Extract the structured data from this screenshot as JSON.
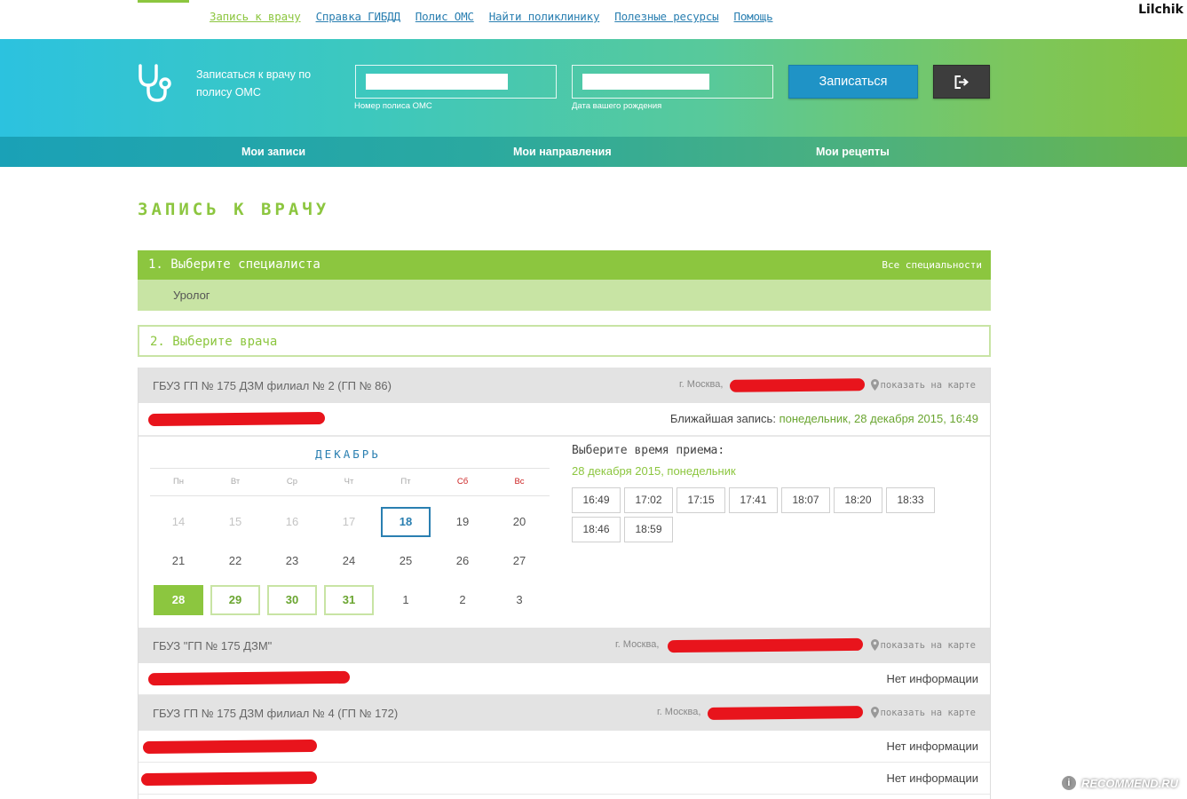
{
  "top_nav": {
    "items": [
      {
        "label": "Запись к врачу",
        "active": true
      },
      {
        "label": "Справка ГИБДД"
      },
      {
        "label": "Полис ОМС"
      },
      {
        "label": "Найти поликлинику"
      },
      {
        "label": "Полезные ресурсы"
      },
      {
        "label": "Помощь"
      }
    ],
    "user": "Lilchik"
  },
  "banner": {
    "icon": "stethoscope-icon",
    "title": "Записаться к врачу по полису ОМС",
    "policy_label": "Номер полиса ОМС",
    "birth_label": "Дата вашего рождения",
    "submit_label": "Записаться",
    "logout_icon": "logout-icon"
  },
  "subnav": [
    "Мои записи",
    "Мои направления",
    "Мои рецепты"
  ],
  "page_title": "ЗАПИСЬ К ВРАЧУ",
  "step1": {
    "title": "1. Выберите специалиста",
    "all_link": "Все специальности",
    "value": "Уролог"
  },
  "step2": {
    "title": "2. Выберите врача"
  },
  "clinics": [
    {
      "name": "ГБУЗ ГП № 175 ДЗМ филиал № 2 (ГП № 86)",
      "city": "г. Москва,",
      "map_link": "показать на карте",
      "doctors": [
        {
          "nearest_label": "Ближайшая запись:",
          "nearest_value": "понедельник, 28 декабря 2015, 16:49"
        }
      ]
    },
    {
      "name": "ГБУЗ \"ГП № 175 ДЗМ\"",
      "city": "г. Москва,",
      "map_link": "показать на карте",
      "doctors": [
        {
          "info": "Нет информации"
        }
      ]
    },
    {
      "name": "ГБУЗ ГП № 175 ДЗМ филиал № 4 (ГП № 172)",
      "city": "г. Москва,",
      "map_link": "показать на карте",
      "doctors": [
        {
          "info": "Нет информации"
        },
        {
          "info": "Нет информации"
        }
      ]
    }
  ],
  "calendar": {
    "month": "ДЕКАБРЬ",
    "weekdays": [
      "Пн",
      "Вт",
      "Ср",
      "Чт",
      "Пт",
      "Сб",
      "Вс"
    ],
    "weeks": [
      [
        {
          "d": "14",
          "s": "past"
        },
        {
          "d": "15",
          "s": "past"
        },
        {
          "d": "16",
          "s": "past"
        },
        {
          "d": "17",
          "s": "past"
        },
        {
          "d": "18",
          "s": "today"
        },
        {
          "d": "19",
          "s": ""
        },
        {
          "d": "20",
          "s": ""
        }
      ],
      [
        {
          "d": "21",
          "s": ""
        },
        {
          "d": "22",
          "s": ""
        },
        {
          "d": "23",
          "s": ""
        },
        {
          "d": "24",
          "s": ""
        },
        {
          "d": "25",
          "s": ""
        },
        {
          "d": "26",
          "s": ""
        },
        {
          "d": "27",
          "s": ""
        }
      ],
      [
        {
          "d": "28",
          "s": "sel"
        },
        {
          "d": "29",
          "s": "avail"
        },
        {
          "d": "30",
          "s": "avail"
        },
        {
          "d": "31",
          "s": "avail"
        },
        {
          "d": "1",
          "s": ""
        },
        {
          "d": "2",
          "s": ""
        },
        {
          "d": "3",
          "s": ""
        }
      ]
    ]
  },
  "times": {
    "title": "Выберите время приема:",
    "date": "28 декабря 2015, понедельник",
    "slots": [
      "16:49",
      "17:02",
      "17:15",
      "17:41",
      "18:07",
      "18:20",
      "18:33",
      "18:46",
      "18:59"
    ]
  },
  "watermark": "RECOMMEND.RU"
}
